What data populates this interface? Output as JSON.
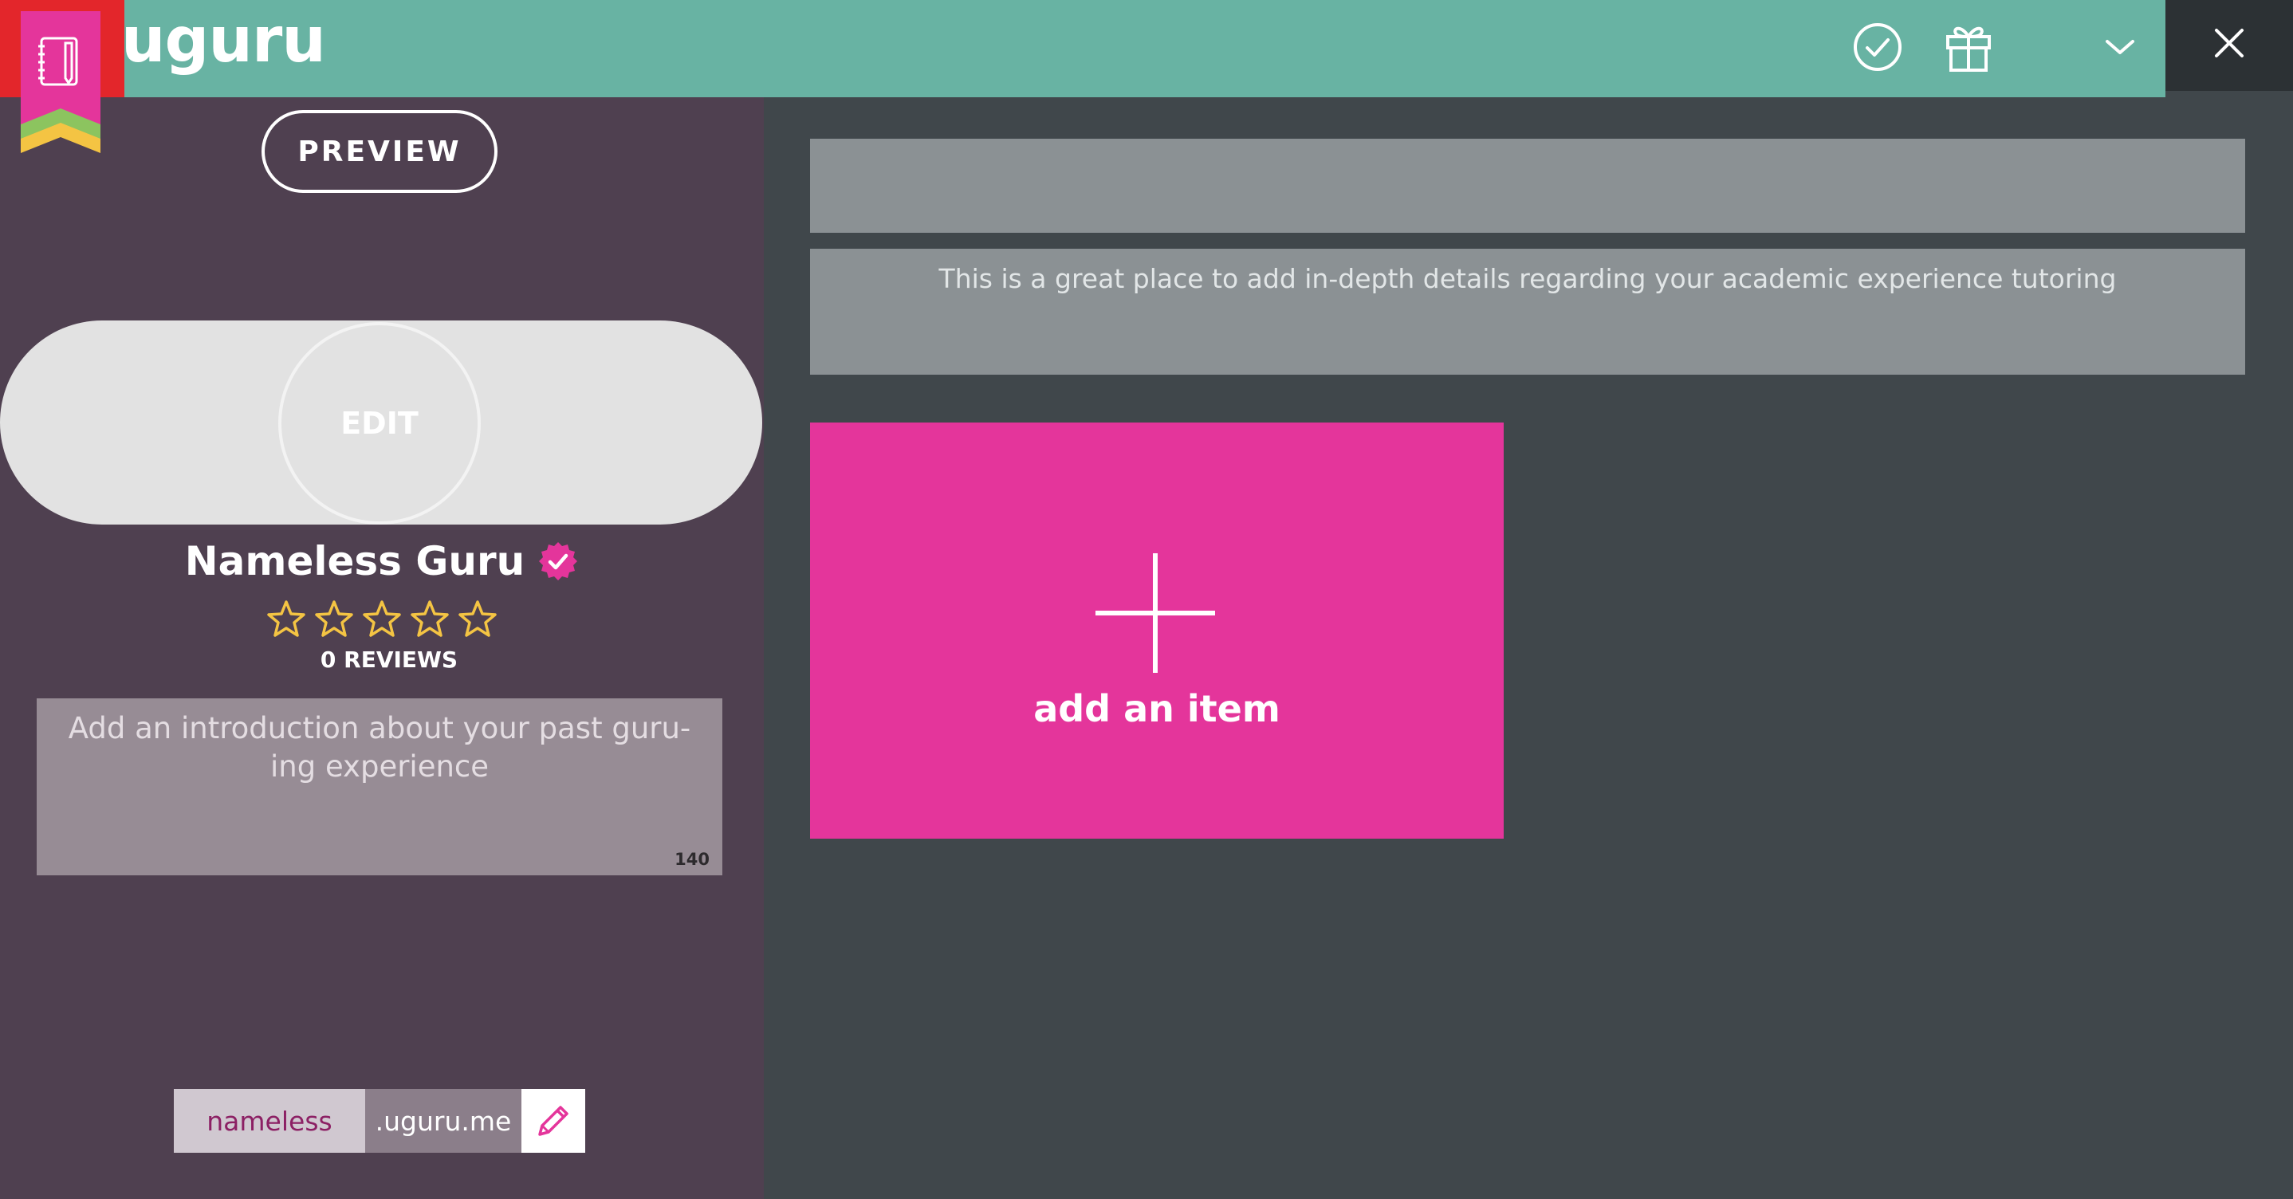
{
  "header": {
    "logo_text": "uguru",
    "icons": [
      "check-circle-icon",
      "gift-icon",
      "chevron-down-icon",
      "close-icon"
    ]
  },
  "sidebar": {
    "preview_label": "PREVIEW",
    "avatar_edit_label": "EDIT",
    "profile_name": "Nameless Guru",
    "rating": {
      "stars_filled": 0,
      "stars_total": 5
    },
    "reviews_label": "0 REVIEWS",
    "intro": {
      "placeholder": "Add an introduction about your past guru-ing experience",
      "char_count": "140"
    },
    "profile_url": {
      "username": "nameless",
      "domain": ".uguru.me"
    }
  },
  "main": {
    "title_field": {
      "placeholder": ""
    },
    "description_field": {
      "placeholder": "This is a great place to add in-depth details regarding your academic experience tutoring"
    },
    "add_item_label": "add an item"
  },
  "colors": {
    "header_green": "#68b3a3",
    "sidebar_purple": "#4f4050",
    "content_bg": "#40474b",
    "accent_pink": "#e4359b",
    "star_gold": "#f4c443",
    "ribbon_red": "#e3262b"
  }
}
